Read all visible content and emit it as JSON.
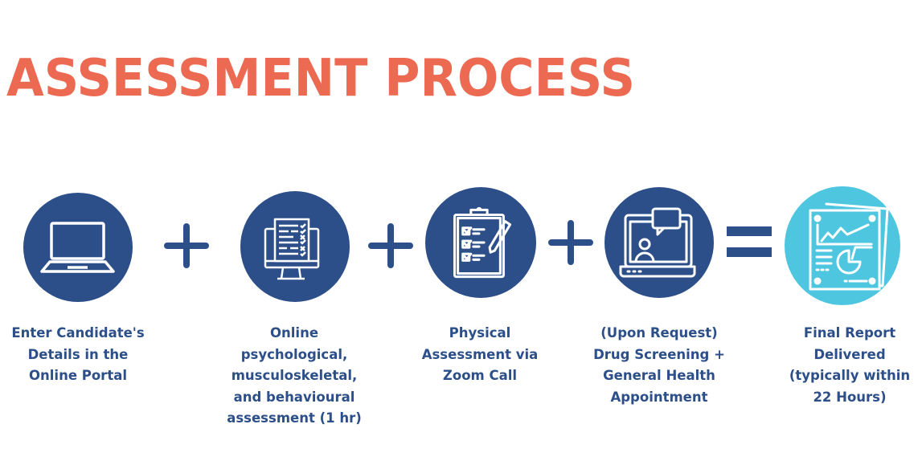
{
  "title": "ASSESSMENT PROCESS",
  "colors": {
    "title": "#ec6a52",
    "step": "#2c4f8a",
    "result": "#4fc6e0",
    "label": "#2c4f8a"
  },
  "steps": [
    {
      "icon": "laptop-icon",
      "label": "Enter Candidate's\nDetails in the\nOnline Portal"
    },
    {
      "icon": "monitor-checklist-icon",
      "label": "Online\npsychological,\nmusculoskeletal,\nand behavioural\nassessment (1 hr)"
    },
    {
      "icon": "clipboard-checklist-icon",
      "label": "Physical\nAssessment via\nZoom Call"
    },
    {
      "icon": "video-call-laptop-icon",
      "label": "(Upon Request)\nDrug Screening +\nGeneral Health\nAppointment"
    },
    {
      "icon": "report-chart-icon",
      "label": "Final Report\nDelivered\n(typically within\n22 Hours)"
    }
  ],
  "operators": [
    "plus-icon",
    "plus-icon",
    "plus-icon",
    "equals-icon"
  ]
}
